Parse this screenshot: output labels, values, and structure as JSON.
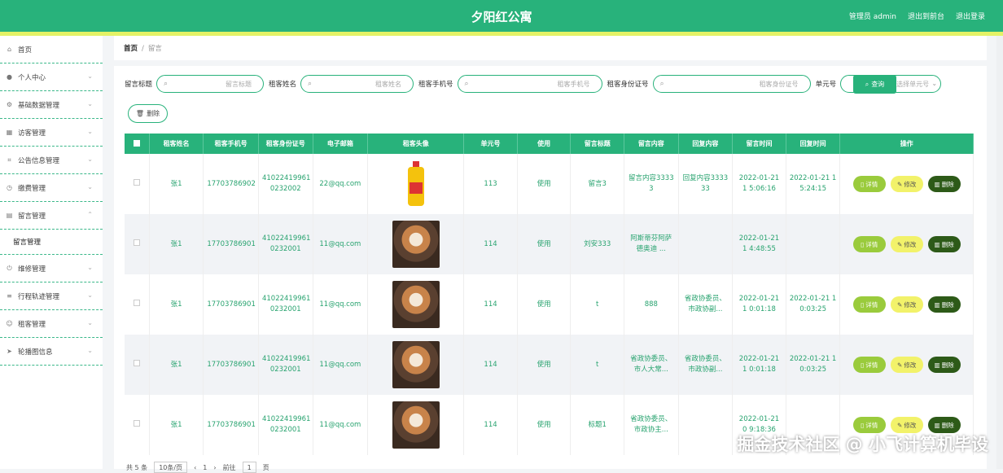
{
  "header": {
    "title": "夕阳红公寓",
    "user": "管理员 admin",
    "back": "退出到前台",
    "logout": "退出登录"
  },
  "sidebar": {
    "items": [
      {
        "label": "首页",
        "icon": "home-icon"
      },
      {
        "label": "个人中心",
        "icon": "user-icon"
      },
      {
        "label": "基础数据管理",
        "icon": "settings-icon"
      },
      {
        "label": "访客管理",
        "icon": "grid-icon"
      },
      {
        "label": "公告信息管理",
        "icon": "crop-icon"
      },
      {
        "label": "缴费管理",
        "icon": "clock-icon"
      },
      {
        "label": "留言管理",
        "icon": "folder-icon"
      },
      {
        "label": "维修管理",
        "icon": "power-icon"
      },
      {
        "label": "行程轨迹管理",
        "icon": "list-icon"
      },
      {
        "label": "租客管理",
        "icon": "people-icon"
      },
      {
        "label": "轮播图信息",
        "icon": "send-icon"
      }
    ],
    "sub_item": "留言管理"
  },
  "breadcrumb": {
    "home": "首页",
    "sep": "/",
    "current": "留言"
  },
  "search": {
    "fields": [
      {
        "label": "留言标题",
        "placeholder": "留言标题"
      },
      {
        "label": "租客姓名",
        "placeholder": "租客姓名"
      },
      {
        "label": "租客手机号",
        "placeholder": "租客手机号"
      },
      {
        "label": "租客身份证号",
        "placeholder": "租客身份证号"
      },
      {
        "label": "单元号",
        "placeholder": "请选择单元号"
      }
    ],
    "query_label": "查询",
    "delete_label": "删除"
  },
  "table": {
    "headers": [
      "租客姓名",
      "租客手机号",
      "租客身份证号",
      "电子邮箱",
      "租客头像",
      "单元号",
      "使用",
      "留言标题",
      "留言内容",
      "回复内容",
      "留言时间",
      "回复时间",
      "操作"
    ],
    "rows": [
      {
        "name": "张1",
        "phone": "17703786902",
        "id": "41022419961 0232002",
        "email": "22@qq.com",
        "avatar": "oil",
        "unit": "113",
        "use": "使用",
        "title": "留言3",
        "content": "留言内容3333 3",
        "reply": "回复内容3333 33",
        "ctime": "2022-01-21 1 5:06:16",
        "rtime": "2022-01-21 1 5:24:15"
      },
      {
        "name": "张1",
        "phone": "17703786901",
        "id": "41022419961 0232001",
        "email": "11@qq.com",
        "avatar": "dog",
        "unit": "114",
        "use": "使用",
        "title": "刘安333",
        "content": "阿斯蒂芬阿萨 德奥迪 ...",
        "reply": "",
        "ctime": "2022-01-21 1 4:48:55",
        "rtime": ""
      },
      {
        "name": "张1",
        "phone": "17703786901",
        "id": "41022419961 0232001",
        "email": "11@qq.com",
        "avatar": "dog",
        "unit": "114",
        "use": "使用",
        "title": "t",
        "content": "888",
        "reply": "省政协委员、 市政协副...",
        "ctime": "2022-01-21 1 0:01:18",
        "rtime": "2022-01-21 1 0:03:25"
      },
      {
        "name": "张1",
        "phone": "17703786901",
        "id": "41022419961 0232001",
        "email": "11@qq.com",
        "avatar": "dog",
        "unit": "114",
        "use": "使用",
        "title": "t",
        "content": "省政协委员、 市人大常...",
        "reply": "省政协委员、 市政协副...",
        "ctime": "2022-01-21 1 0:01:18",
        "rtime": "2022-01-21 1 0:03:25"
      },
      {
        "name": "张1",
        "phone": "17703786901",
        "id": "41022419961 0232001",
        "email": "11@qq.com",
        "avatar": "dog",
        "unit": "114",
        "use": "使用",
        "title": "标题1",
        "content": "省政协委员、 市政协主...",
        "reply": "",
        "ctime": "2022-01-21 0 9:18:36",
        "rtime": ""
      }
    ],
    "ops": {
      "detail": "详情",
      "edit": "修改",
      "delete": "删除"
    }
  },
  "pager": {
    "total": "共 5 条",
    "size": "10条/页",
    "page": "1",
    "goto": "前往",
    "page_box": "1",
    "unit": "页"
  },
  "watermark": "掘金技术社区 @ 小飞计算机毕设"
}
